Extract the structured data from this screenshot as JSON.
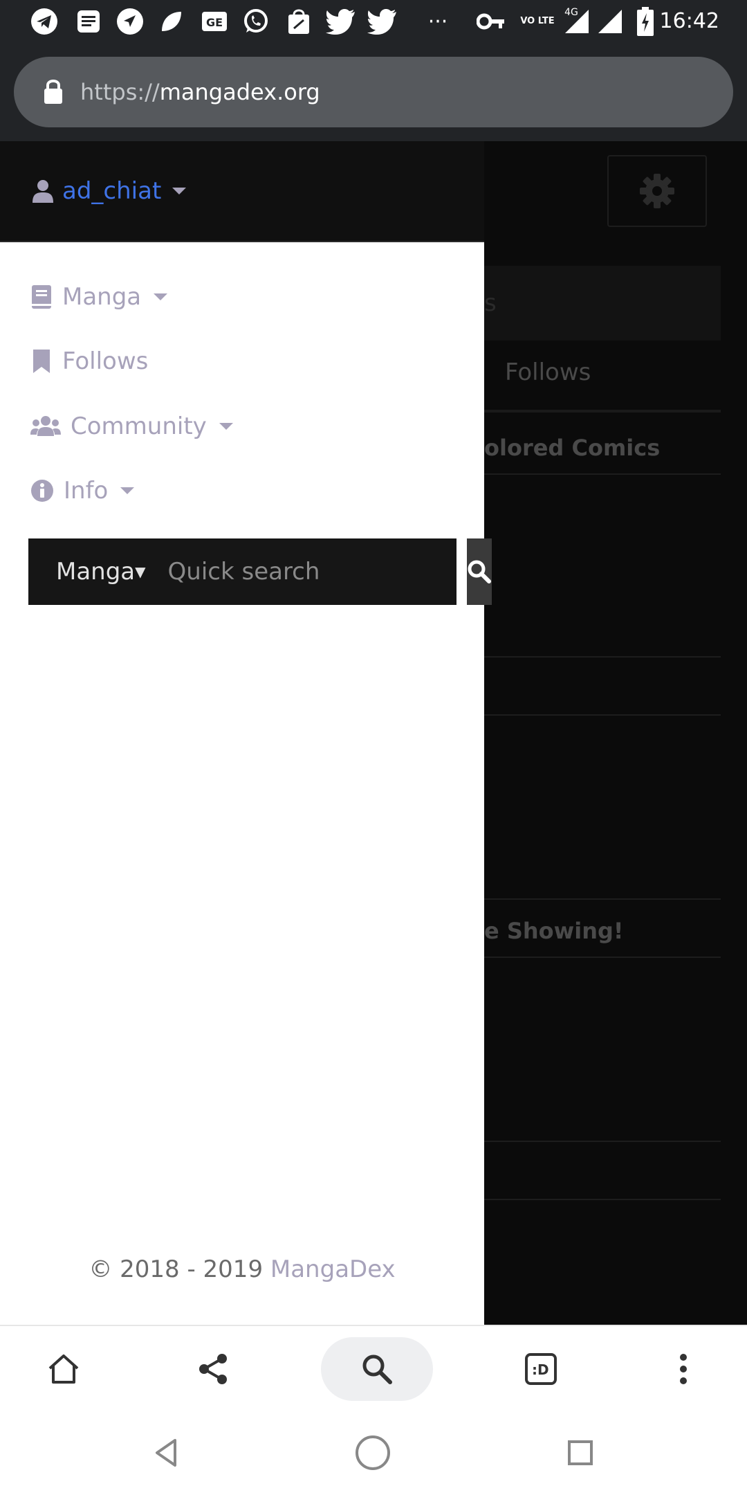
{
  "status_bar": {
    "time": "16:42",
    "network_label": "4G",
    "volte_label": "VO LTE",
    "overflow": "···",
    "icons": [
      "telegram-icon",
      "news-icon",
      "send-icon",
      "leaf-icon",
      "ge-icon",
      "whatsapp-icon",
      "shopping-bag-icon",
      "twitter-icon",
      "twitter-icon",
      "more-icon",
      "key-icon",
      "volte-icon",
      "signal-icon",
      "battery-charging-icon"
    ]
  },
  "browser": {
    "url_scheme": "https://",
    "url_host": "mangadex.org"
  },
  "drawer": {
    "username": "ad_chiat",
    "nav": [
      {
        "label": "Manga",
        "icon": "book-icon",
        "dropdown": true
      },
      {
        "label": "Follows",
        "icon": "bookmark-icon",
        "dropdown": false
      },
      {
        "label": "Community",
        "icon": "users-icon",
        "dropdown": true
      },
      {
        "label": "Info",
        "icon": "info-icon",
        "dropdown": true
      }
    ],
    "search": {
      "type_value": "Manga",
      "placeholder": "Quick search"
    },
    "copyright": "© 2018 - 2019",
    "brand": "MangaDex"
  },
  "background_page": {
    "strip_text": "s",
    "follows_label": "Follows",
    "heading_1": "olored Comics",
    "heading_2": "e Showing!"
  },
  "colors": {
    "accent": "#3f73e7",
    "nav_text": "#a7a2ba",
    "status_bar": "#222427"
  }
}
